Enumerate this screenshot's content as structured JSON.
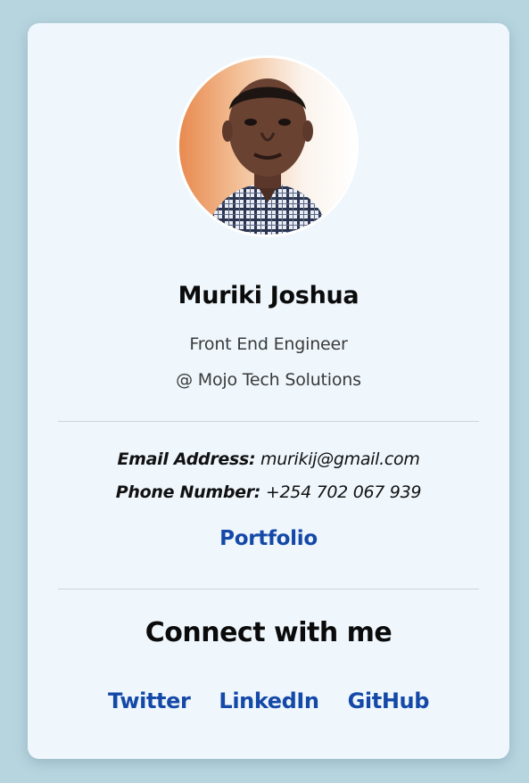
{
  "profile": {
    "name": "Muriki Joshua",
    "role": "Front End Engineer",
    "company": "@ Mojo Tech Solutions"
  },
  "contact": {
    "email_label": "Email Address:",
    "email_value": "murikij@gmail.com",
    "phone_label": "Phone Number:",
    "phone_value": "+254 702 067 939",
    "portfolio_label": "Portfolio"
  },
  "connect": {
    "title": "Connect with me",
    "links": [
      "Twitter",
      "LinkedIn",
      "GitHub"
    ]
  },
  "colors": {
    "page_background": "#b7d5df",
    "card_background": "#eff7fd",
    "link": "#1549a8",
    "text": "#0b0b0b"
  }
}
